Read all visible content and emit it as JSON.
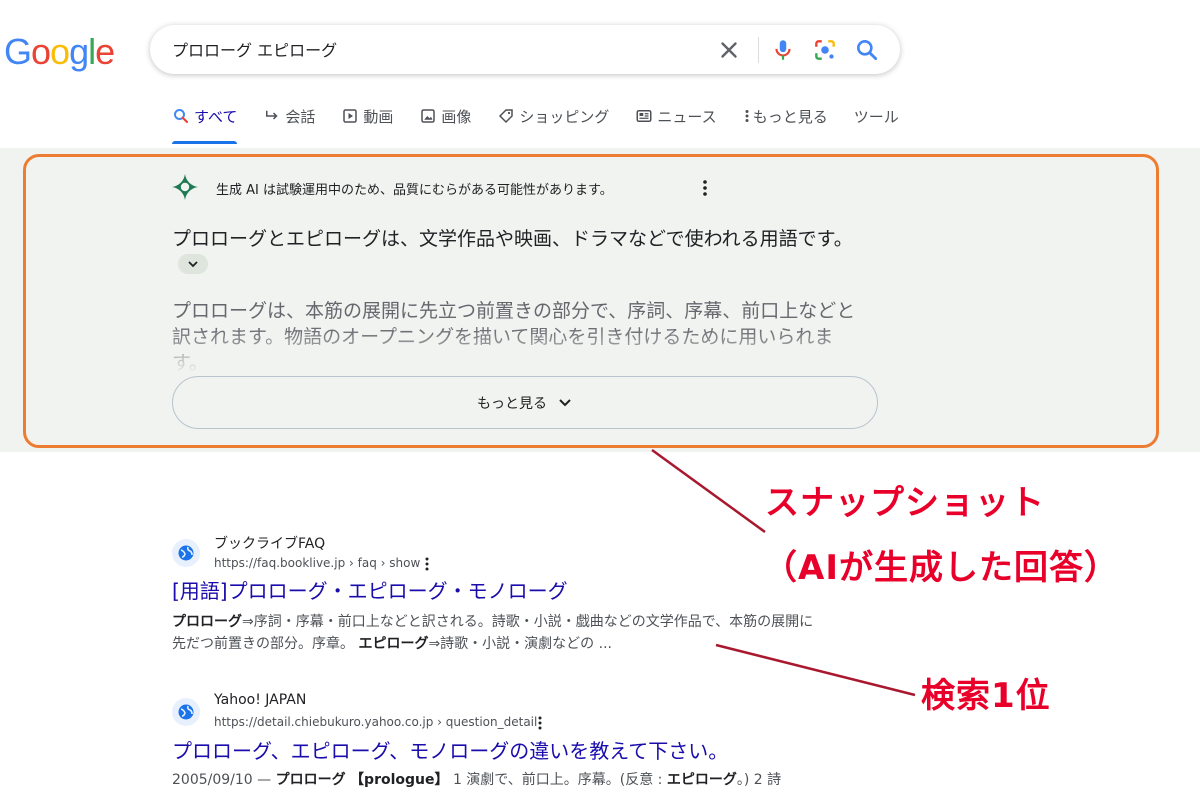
{
  "logo": {
    "text": "Google",
    "letters": [
      {
        "ch": "G",
        "color": "#4285F4"
      },
      {
        "ch": "o",
        "color": "#EA4335"
      },
      {
        "ch": "o",
        "color": "#FBBC05"
      },
      {
        "ch": "g",
        "color": "#4285F4"
      },
      {
        "ch": "l",
        "color": "#34A853"
      },
      {
        "ch": "e",
        "color": "#EA4335"
      }
    ]
  },
  "search": {
    "query": "プロローグ エピローグ"
  },
  "tabs": [
    {
      "label": "すべて",
      "icon": "search-icon",
      "active": true
    },
    {
      "label": "会話",
      "icon": "reply-arrow-icon"
    },
    {
      "label": "動画",
      "icon": "play-icon"
    },
    {
      "label": "画像",
      "icon": "image-icon"
    },
    {
      "label": "ショッピング",
      "icon": "tag-icon"
    },
    {
      "label": "ニュース",
      "icon": "newspaper-icon"
    },
    {
      "label": "もっと見る",
      "icon": "more-vert-icon"
    },
    {
      "label": "ツール",
      "icon": ""
    }
  ],
  "ai": {
    "notice": "生成 AI は試験運用中のため、品質にむらがある可能性があります。",
    "main_text": "プロローグとエピローグは、文学作品や映画、ドラマなどで使われる用語です。",
    "sub_text": "プロローグは、本筋の展開に先立つ前置きの部分で、序詞、序幕、前口上などと訳されます。物語のオープニングを描いて関心を引き付けるために用いられます。",
    "more_label": "もっと見る",
    "accent_color": "#ed7d31"
  },
  "results": [
    {
      "site": "ブックライブFAQ",
      "url": "https://faq.booklive.jp › faq › show",
      "title": "[用語]プロローグ・エピローグ・モノローグ",
      "snippet": [
        {
          "b": "プロローグ"
        },
        {
          "t": "⇒序詞・序幕・前口上などと訳される。詩歌・小説・戯曲などの文学作品で、本筋の展開に先だつ前置きの部分。序章。 "
        },
        {
          "b": "エピローグ"
        },
        {
          "t": "⇒詩歌・小説・演劇などの ..."
        }
      ]
    },
    {
      "site": "Yahoo! JAPAN",
      "url": "https://detail.chiebukuro.yahoo.co.jp › question_detail",
      "title": "プロローグ、エピローグ、モノローグの違いを教えて下さい。",
      "snippet": [
        {
          "t": "2005/09/10 — "
        },
        {
          "b": "プロローグ"
        },
        {
          "t": " "
        },
        {
          "b": "【prologue】"
        },
        {
          "t": " 1 演劇で、前口上。序幕。(反意 : "
        },
        {
          "b": "エピローグ"
        },
        {
          "t": "。) 2 詩"
        }
      ]
    }
  ],
  "annotations": {
    "snapshot_line1": "スナップショット",
    "snapshot_line2": "（AIが生成した回答）",
    "rank": "検索1位",
    "color": "#e8002a"
  }
}
